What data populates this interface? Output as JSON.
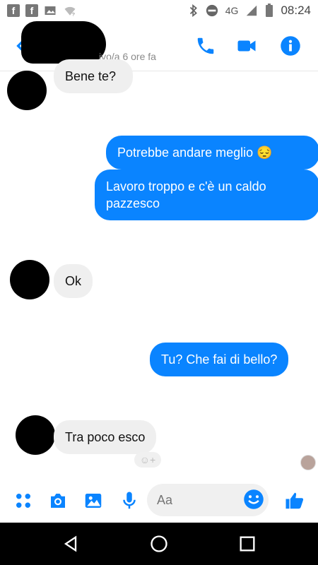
{
  "status_bar": {
    "left_icons": [
      "f",
      "f"
    ],
    "network": "4G",
    "time": "08:24"
  },
  "header": {
    "subtitle": "ivo/a 6 ore fa"
  },
  "messages": [
    {
      "side": "them",
      "text": "Bene te?"
    },
    {
      "side": "me",
      "text": "Potrebbe andare meglio 😔"
    },
    {
      "side": "me",
      "text": "Lavoro troppo e c'è un caldo pazzesco"
    },
    {
      "side": "them",
      "text": "Ok"
    },
    {
      "side": "me",
      "text": "Tu? Che fai di bello?"
    },
    {
      "side": "them",
      "text": "Tra poco esco"
    }
  ],
  "composer": {
    "placeholder": "Aa"
  },
  "colors": {
    "accent": "#0a84ff"
  }
}
